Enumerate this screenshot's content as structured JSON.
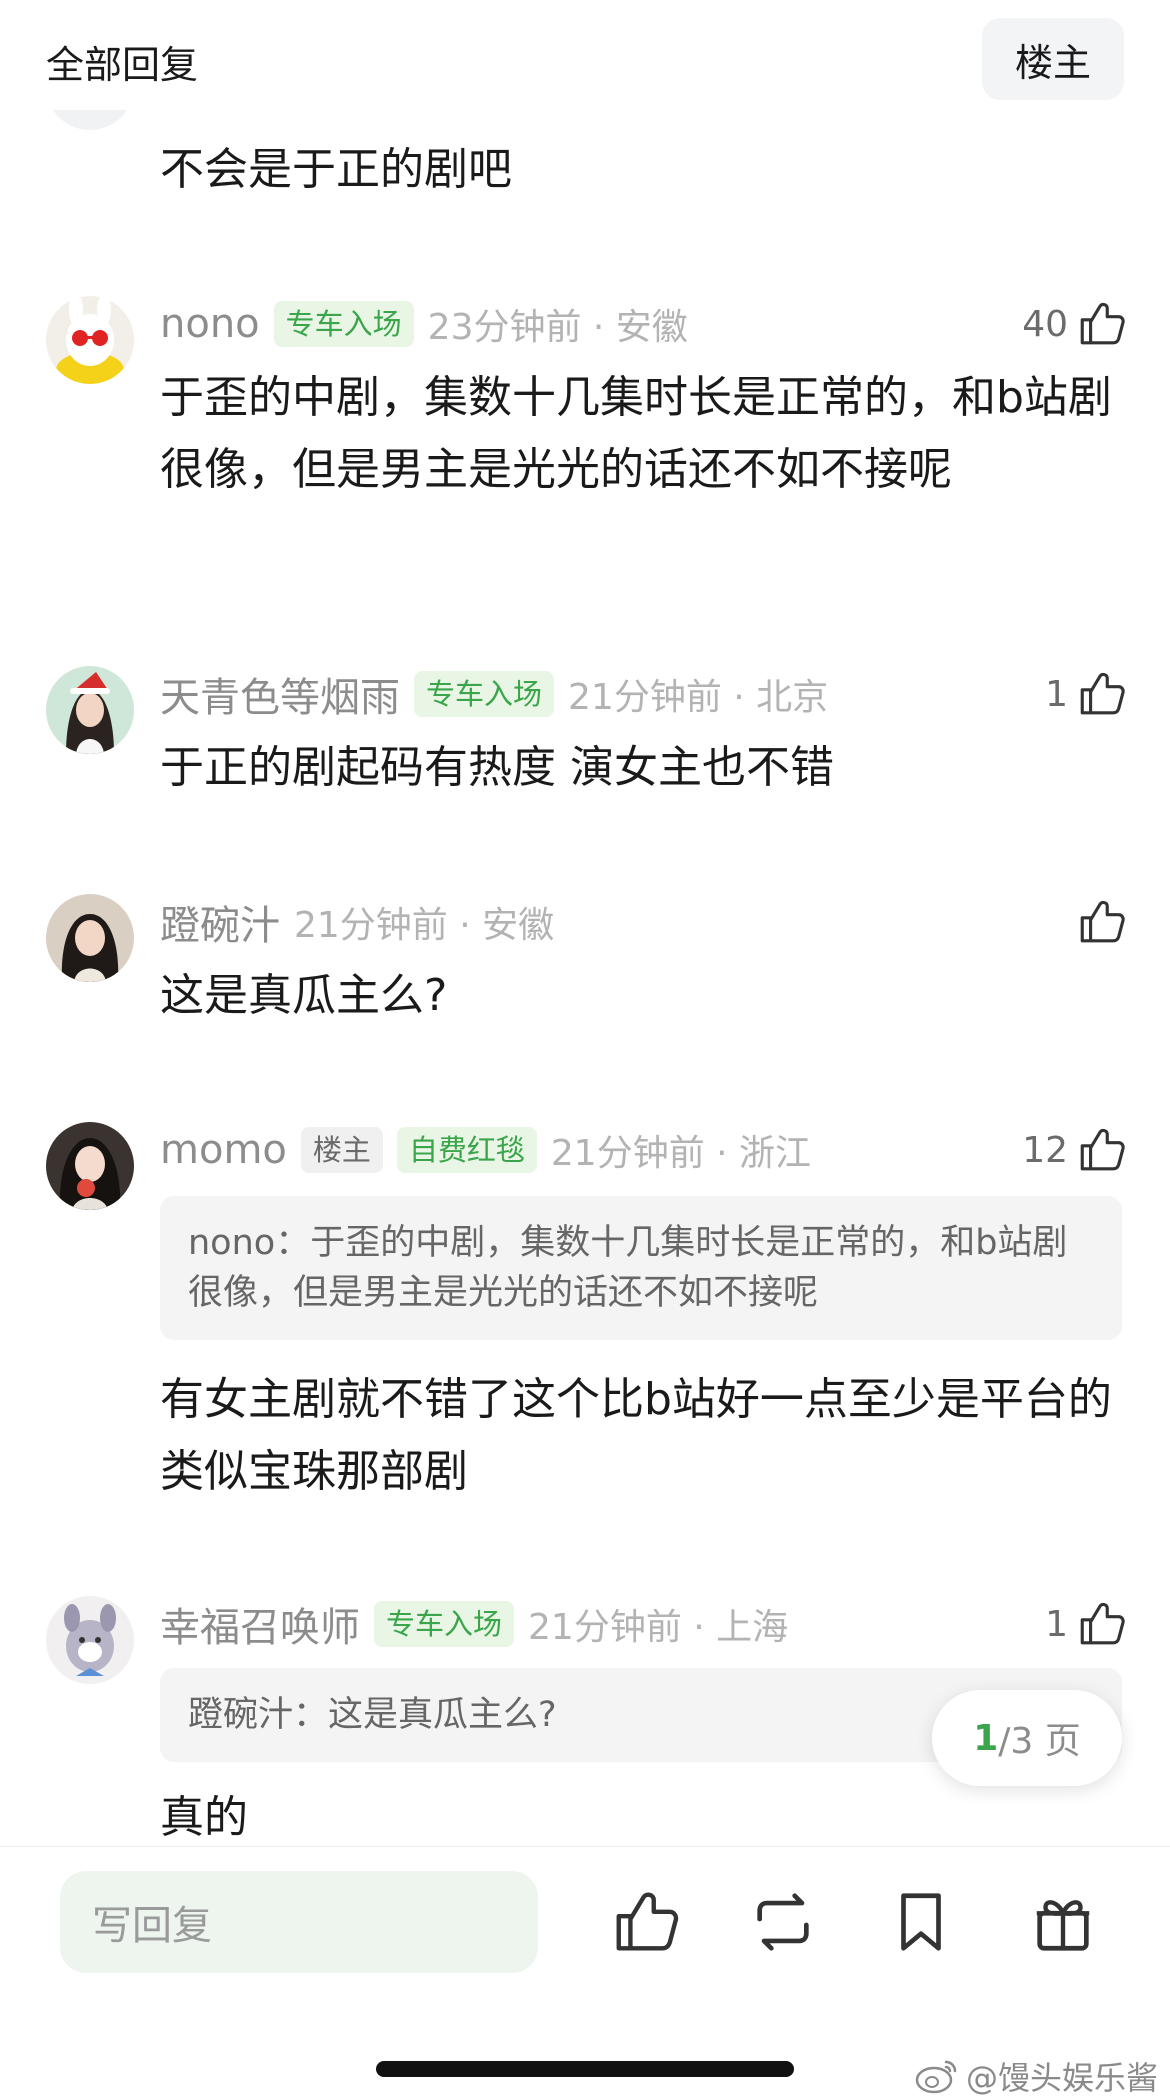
{
  "header": {
    "title": "全部回复",
    "op_button": "楼主"
  },
  "comments": [
    {
      "text": "不会是于正的剧吧"
    },
    {
      "username": "nono",
      "tags": [
        "专车入场"
      ],
      "time": "23分钟前 · 安徽",
      "likes": "40",
      "text": "于歪的中剧，集数十几集时长是正常的，和b站剧很像，但是男主是光光的话还不如不接呢"
    },
    {
      "username": "天青色等烟雨",
      "tags": [
        "专车入场"
      ],
      "time": "21分钟前 · 北京",
      "likes": "1",
      "text": "于正的剧起码有热度 演女主也不错"
    },
    {
      "username": "蹬碗汁",
      "tags": [],
      "time": "21分钟前 · 安徽",
      "likes": "",
      "text": "这是真瓜主么?"
    },
    {
      "username": "momo",
      "tags": [
        "楼主",
        "自费红毯"
      ],
      "time": "21分钟前 · 浙江",
      "likes": "12",
      "quote": "nono：于歪的中剧，集数十几集时长是正常的，和b站剧很像，但是男主是光光的话还不如不接呢",
      "text": "有女主剧就不错了这个比b站好一点至少是平台的类似宝珠那部剧"
    },
    {
      "username": "幸福召唤师",
      "tags": [
        "专车入场"
      ],
      "time": "21分钟前 · 上海",
      "likes": "1",
      "quote": "蹬碗汁：这是真瓜主么?",
      "text": "真的"
    }
  ],
  "pager": {
    "current": "1",
    "total": "/3 页"
  },
  "bottom_bar": {
    "reply_placeholder": "写回复"
  },
  "watermark": "@馒头娱乐酱",
  "colors": {
    "accent_green": "#3aa54a",
    "tag_bg": "#e9f6e6",
    "muted": "#b3b3b3"
  },
  "icons": [
    "thumbs-up-icon",
    "repost-icon",
    "bookmark-icon",
    "gift-icon",
    "weibo-icon"
  ]
}
